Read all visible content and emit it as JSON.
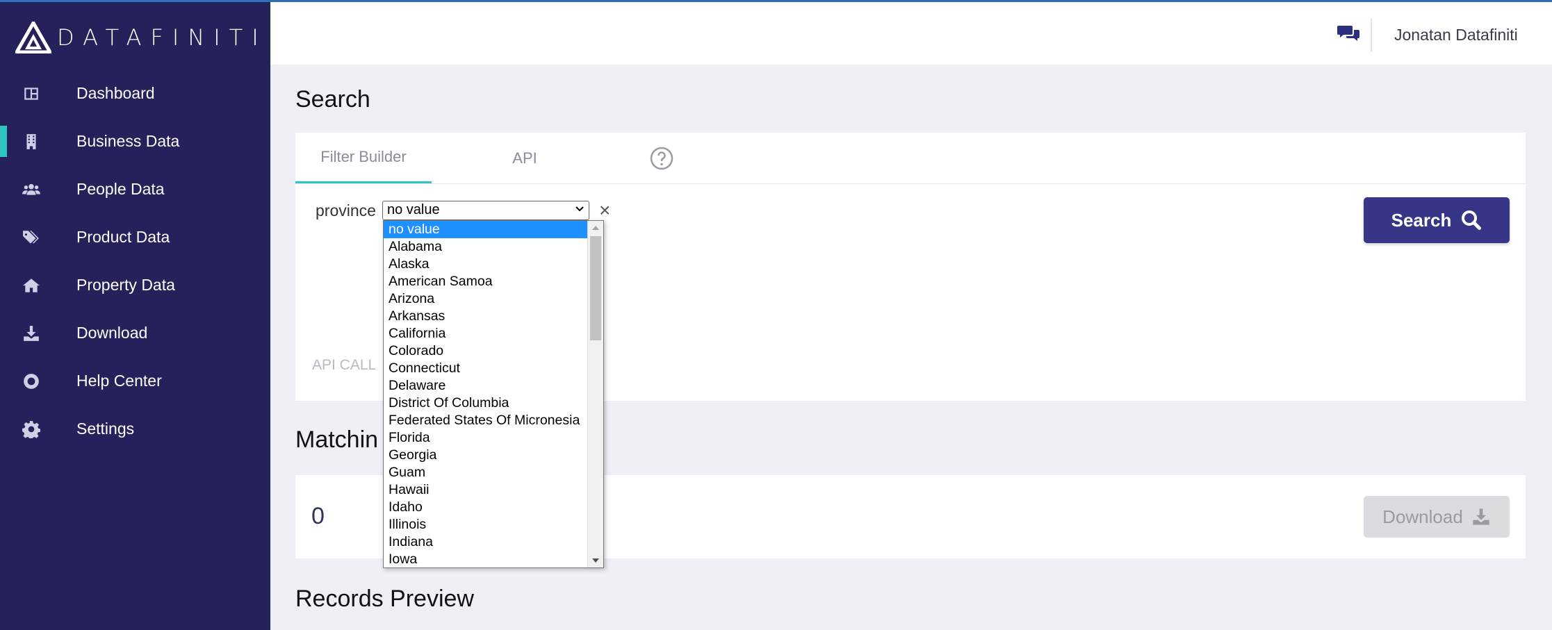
{
  "brand": {
    "name": "DATAFINITI",
    "accent": "#2ec4c4",
    "sidebar_bg": "#25215a",
    "primary_button": "#373587"
  },
  "sidebar": {
    "items": [
      {
        "label": "Dashboard",
        "icon": "dashboard-icon",
        "active": false
      },
      {
        "label": "Business Data",
        "icon": "building-icon",
        "active": true
      },
      {
        "label": "People Data",
        "icon": "users-icon",
        "active": false
      },
      {
        "label": "Product Data",
        "icon": "tags-icon",
        "active": false
      },
      {
        "label": "Property Data",
        "icon": "home-icon",
        "active": false
      },
      {
        "label": "Download",
        "icon": "download-icon",
        "active": false
      },
      {
        "label": "Help Center",
        "icon": "life-ring-icon",
        "active": false
      },
      {
        "label": "Settings",
        "icon": "gear-icon",
        "active": false
      }
    ]
  },
  "header": {
    "user_name": "Jonatan Datafiniti",
    "chat_icon": "chat-icon"
  },
  "search": {
    "title": "Search",
    "tabs": [
      {
        "label": "Filter Builder",
        "active": true
      },
      {
        "label": "API",
        "active": false
      }
    ],
    "help_icon": "question-circle-icon",
    "filter": {
      "field_label": "province",
      "selected_value": "no value",
      "clear": "×"
    },
    "search_button": "Search",
    "api_calls_label": "API CALL"
  },
  "matching": {
    "title": "Matchin",
    "count": "0",
    "download_button": "Download"
  },
  "records_preview": {
    "title": "Records Preview"
  },
  "dropdown": {
    "options": [
      "no value",
      "Alabama",
      "Alaska",
      "American Samoa",
      "Arizona",
      "Arkansas",
      "California",
      "Colorado",
      "Connecticut",
      "Delaware",
      "District Of Columbia",
      "Federated States Of Micronesia",
      "Florida",
      "Georgia",
      "Guam",
      "Hawaii",
      "Idaho",
      "Illinois",
      "Indiana",
      "Iowa"
    ],
    "selected_index": 0
  }
}
